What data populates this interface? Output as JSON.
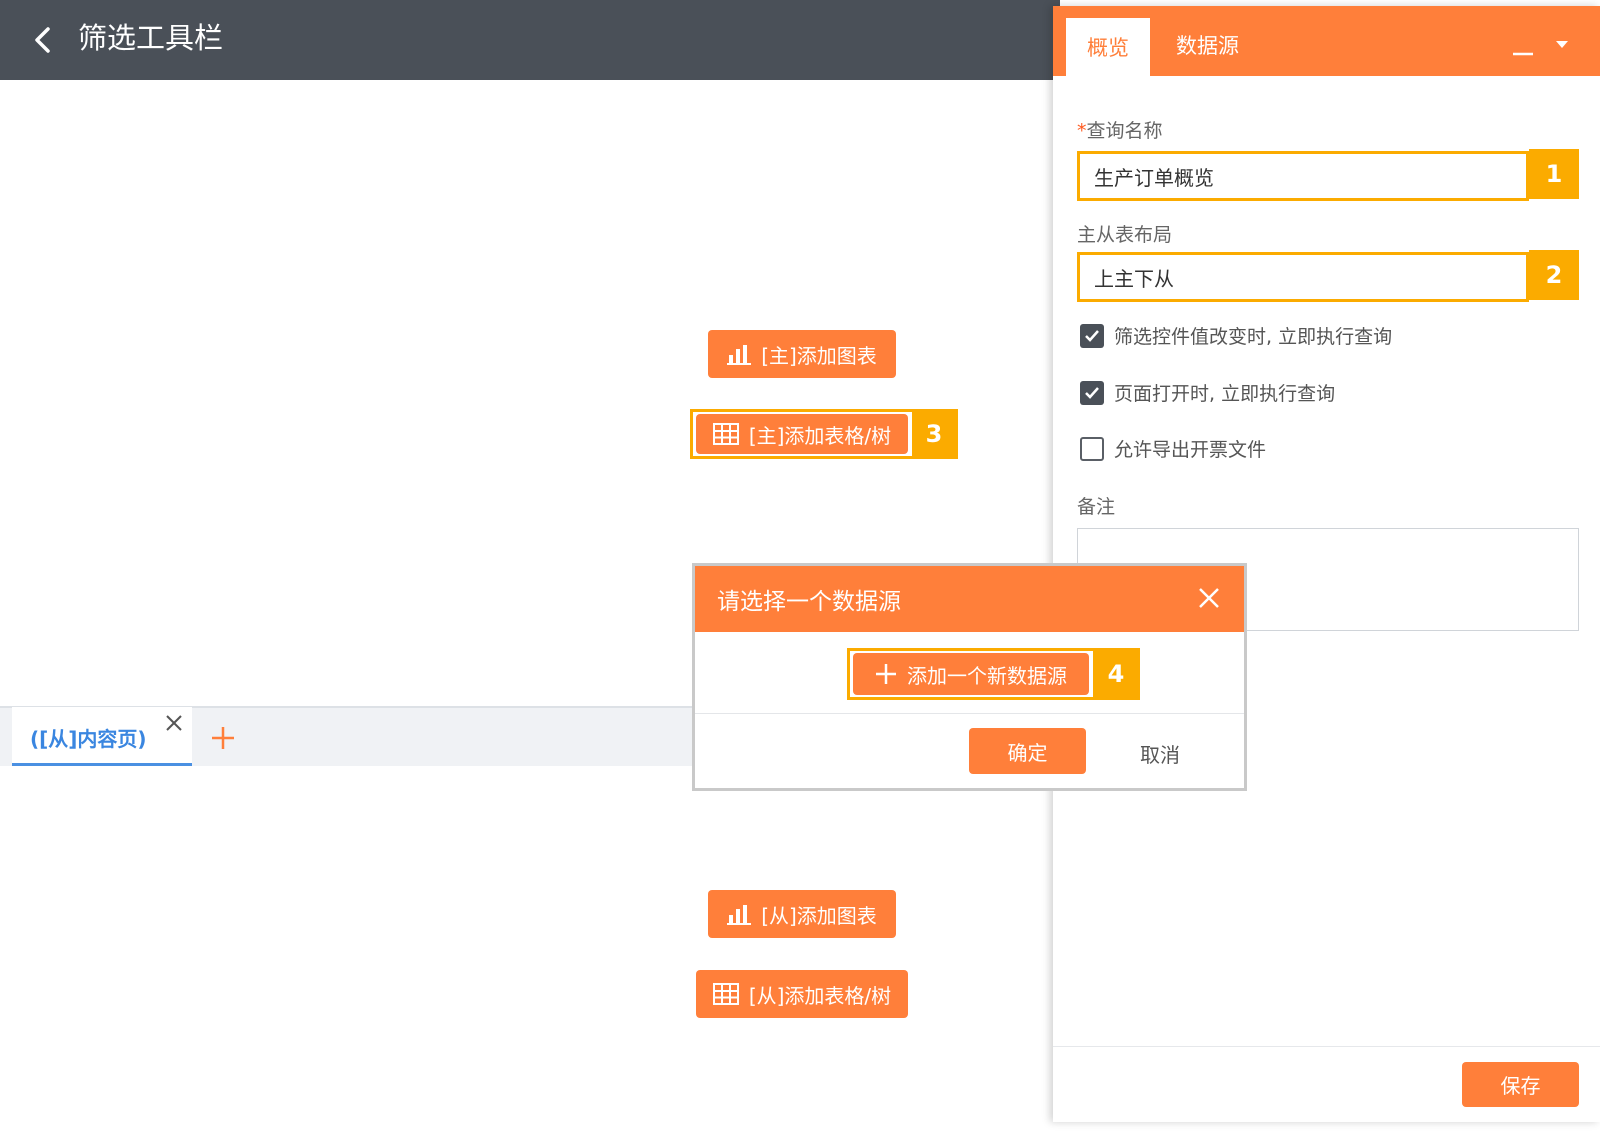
{
  "header": {
    "title": "筛选工具栏"
  },
  "canvas": {
    "main_add_chart": "[主]添加图表",
    "main_add_table": "[主]添加表格/树",
    "sub_add_chart": "[从]添加图表",
    "sub_add_table": "[从]添加表格/树",
    "tabs": [
      {
        "label": "([从]内容页)"
      }
    ]
  },
  "panel": {
    "tabs": [
      {
        "label": "概览",
        "active": true
      },
      {
        "label": "数据源",
        "active": false
      }
    ],
    "query_name": {
      "required_mark": "*",
      "label": "查询名称",
      "value": "生产订单概览"
    },
    "layout": {
      "label": "主从表布局",
      "value": "上主下从"
    },
    "checkboxes": [
      {
        "label": "筛选控件值改变时, 立即执行查询",
        "checked": true
      },
      {
        "label": "页面打开时, 立即执行查询",
        "checked": true
      },
      {
        "label": "允许导出开票文件",
        "checked": false
      }
    ],
    "remark": {
      "label": "备注",
      "value": ""
    },
    "save_label": "保存"
  },
  "modal": {
    "title": "请选择一个数据源",
    "add_label": "添加一个新数据源",
    "confirm_label": "确定",
    "cancel_label": "取消"
  },
  "badges": [
    "1",
    "2",
    "3",
    "4"
  ],
  "colors": {
    "accent": "#ff7f3a",
    "highlight": "#fbab00",
    "header": "#4a5058",
    "link": "#3a86e0"
  }
}
